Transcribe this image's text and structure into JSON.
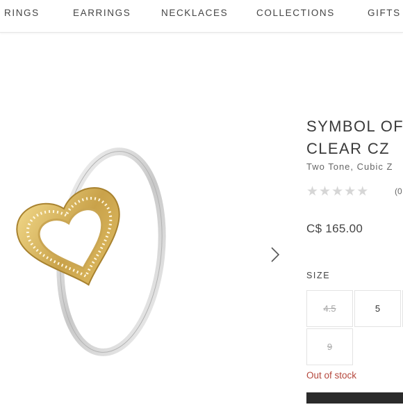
{
  "nav": {
    "items": [
      {
        "label": "RINGS"
      },
      {
        "label": "EARRINGS"
      },
      {
        "label": "NECKLACES"
      },
      {
        "label": "COLLECTIONS"
      },
      {
        "label": "GIFTS"
      }
    ]
  },
  "product": {
    "title_line1": "SYMBOL OF",
    "title_line2": "CLEAR CZ",
    "subtitle": "Two Tone, Cubic Z",
    "rating": 0,
    "rating_max": 5,
    "review_count": "(0",
    "price": "C$ 165.00",
    "size_label": "SIZE",
    "sizes": [
      {
        "value": "4.5",
        "available": false
      },
      {
        "value": "5",
        "available": true
      },
      {
        "value": "9",
        "available": false
      }
    ],
    "stock_status": "Out of stock"
  },
  "colors": {
    "accent_out_of_stock": "#b5483d",
    "button_dark": "#2b2b2b",
    "star_empty": "#d6d6d6",
    "gold": "#c9a24a",
    "silver": "#d9d9d9"
  }
}
